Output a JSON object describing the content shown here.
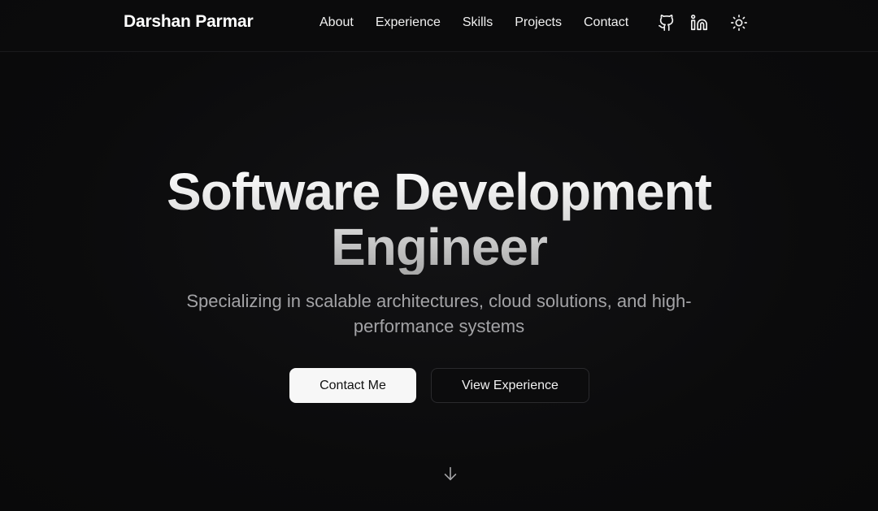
{
  "navbar": {
    "brand": "Darshan Parmar",
    "links": [
      "About",
      "Experience",
      "Skills",
      "Projects",
      "Contact"
    ],
    "icons": [
      "github-icon",
      "linkedin-icon",
      "sun-icon"
    ]
  },
  "hero": {
    "title_line1": "Software Development",
    "title_line2": "Engineer",
    "subtitle": "Specializing in scalable architectures, cloud solutions, and high-performance systems",
    "primary_button": "Contact Me",
    "secondary_button": "View Experience",
    "scroll_icon": "arrow-down-icon"
  },
  "colors": {
    "background": "#0b0b0c",
    "text": "#f2f2f2",
    "subtitle": "#a3a3a6",
    "primary_button_bg": "#f7f7f7",
    "secondary_button_border": "#2a2a2d"
  }
}
